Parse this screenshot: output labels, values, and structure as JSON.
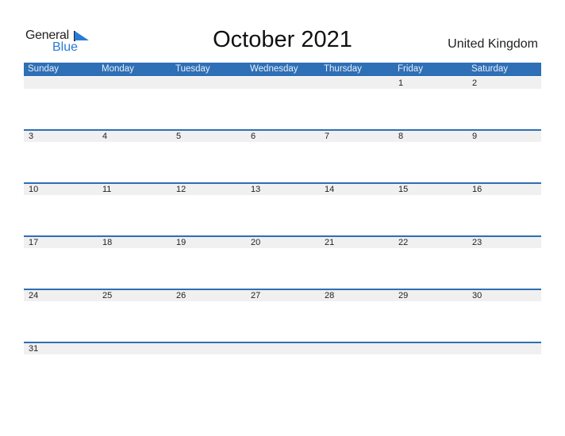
{
  "logo": {
    "general": "General",
    "blue": "Blue",
    "accent_color": "#2a7bd6"
  },
  "title": "October 2021",
  "country": "United Kingdom",
  "header_color": "#2e6fb5",
  "weekdays": [
    "Sunday",
    "Monday",
    "Tuesday",
    "Wednesday",
    "Thursday",
    "Friday",
    "Saturday"
  ],
  "weeks": [
    [
      "",
      "",
      "",
      "",
      "",
      "1",
      "2"
    ],
    [
      "3",
      "4",
      "5",
      "6",
      "7",
      "8",
      "9"
    ],
    [
      "10",
      "11",
      "12",
      "13",
      "14",
      "15",
      "16"
    ],
    [
      "17",
      "18",
      "19",
      "20",
      "21",
      "22",
      "23"
    ],
    [
      "24",
      "25",
      "26",
      "27",
      "28",
      "29",
      "30"
    ],
    [
      "31",
      "",
      "",
      "",
      "",
      "",
      ""
    ]
  ]
}
